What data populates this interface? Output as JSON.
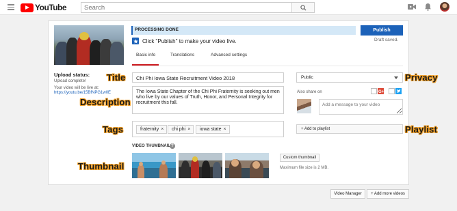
{
  "header": {
    "logo_text": "YouTube",
    "search_placeholder": "Search",
    "icons": [
      "menu-icon",
      "search-icon",
      "video-camera-icon",
      "bell-icon"
    ]
  },
  "status": {
    "processing": "PROCESSING DONE",
    "publish_label": "Publish",
    "draft_saved": "Draft saved.",
    "hint": "Click \"Publish\" to make your video live."
  },
  "tabs": [
    {
      "label": "Basic info",
      "active": true
    },
    {
      "label": "Translations",
      "active": false
    },
    {
      "label": "Advanced settings",
      "active": false
    }
  ],
  "upload": {
    "status_label": "Upload status:",
    "complete": "Upload complete!",
    "live_at": "Your video will be live at:",
    "url": "https://youtu.be/15BfNPG1w0E"
  },
  "form": {
    "title": "Chi Phi Iowa State Recruitment Video 2018",
    "description": "The Iowa State Chapter of the Chi Phi Fraternity is seeking out men who live by our values of Truth, Honor, and Personal Integrity for recruitment this fall.",
    "tags": [
      "fraternity",
      "chi phi",
      "iowa state"
    ],
    "tag_remove": "×"
  },
  "sidebar": {
    "privacy": "Public",
    "also_share": "Also share on",
    "message_placeholder": "Add a message to your video",
    "add_playlist": "+ Add to playlist"
  },
  "thumbnails": {
    "label": "VIDEO THUMBNAILS",
    "help": "?",
    "custom_label": "Custom thumbnail",
    "max_size": "Maximum file size is 2 MB."
  },
  "footer": {
    "video_manager": "Video Manager",
    "add_more": "+ Add more videos"
  },
  "annotations": {
    "title": "Title",
    "description": "Description",
    "tags": "Tags",
    "thumbnail": "Thumbnail",
    "privacy": "Privacy",
    "playlist": "Playlist"
  },
  "colors": {
    "accent": "#1c62b9",
    "brand_red": "#ff0000",
    "annotation_outline": "#f0a02a"
  }
}
